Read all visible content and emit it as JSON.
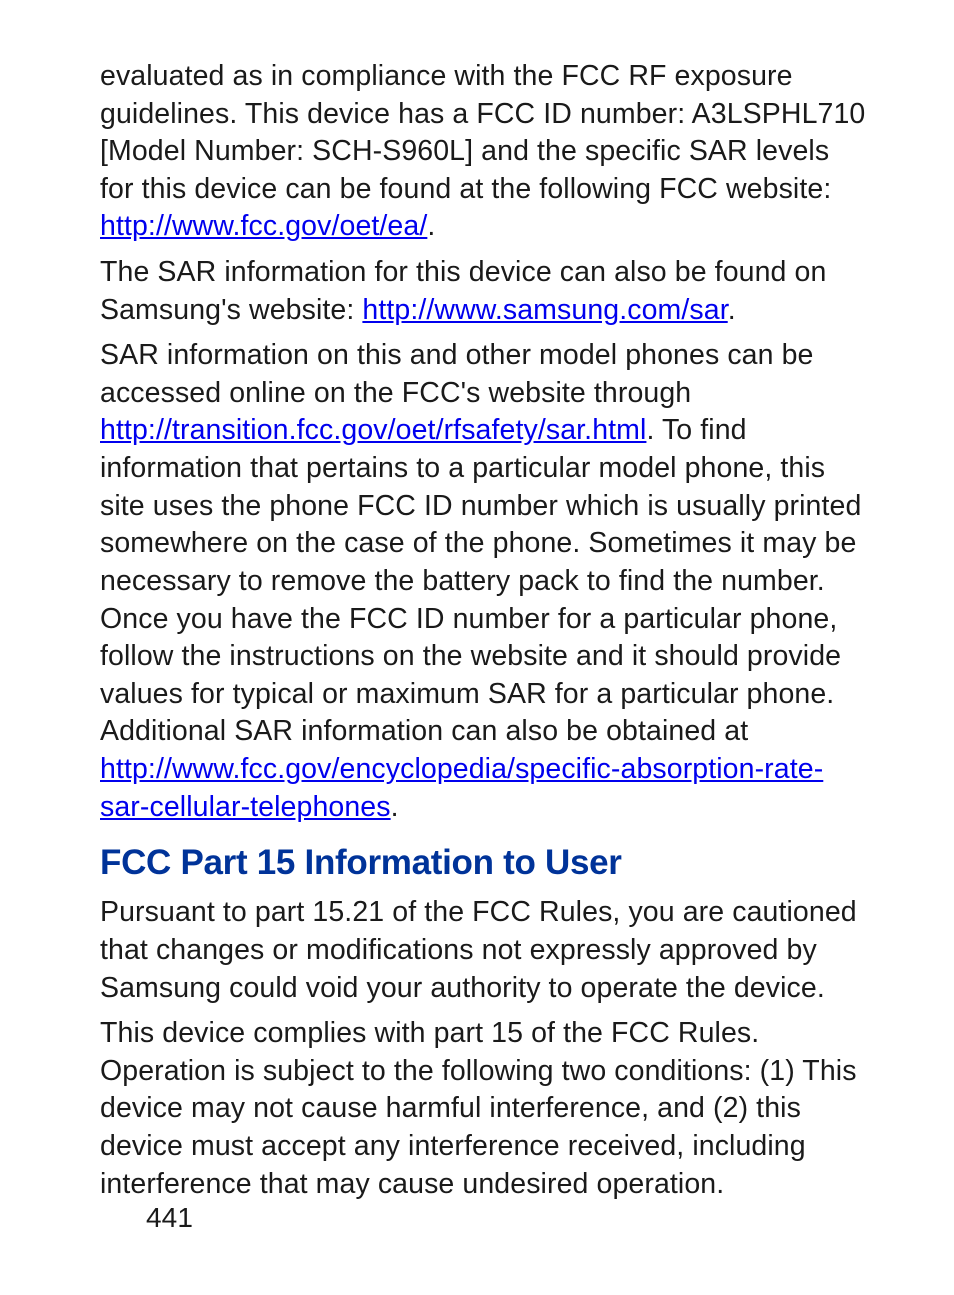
{
  "paragraphs": {
    "p1": {
      "t1": "evaluated as in compliance with the FCC RF exposure guidelines. This device has a FCC ID number: A3LSPHL710 [Model Number: SCH-S960L] and the specific SAR levels for this device can be found at the following FCC website: ",
      "link1": "http://www.fcc.gov/oet/ea/",
      "t2": "."
    },
    "p2": {
      "t1": "The SAR information for this device can also be found on Samsung's website: ",
      "link1": "http://www.samsung.com/sar",
      "t2": "."
    },
    "p3": {
      "t1": "SAR information on this and other model phones can be accessed online on the FCC's website through ",
      "link1": "http://transition.fcc.gov/oet/rfsafety/sar.html",
      "t2": ". To find information that pertains to a particular model phone, this site uses the phone FCC ID number which is usually printed somewhere on the case of the phone. Sometimes it may be necessary to remove the battery pack to find the number. Once you have the FCC ID number for a particular phone, follow the instructions on the website and it should provide values for typical or maximum SAR for a particular phone. Additional SAR information can also be obtained at ",
      "link2": "http://www.fcc.gov/encyclopedia/specific-absorption-rate-sar-cellular-telephones",
      "t3": "."
    },
    "heading1": "FCC Part 15 Information to User",
    "p4": "Pursuant to part 15.21 of the FCC Rules, you are cautioned that changes or modifications not expressly approved by Samsung could void your authority to operate the device.",
    "p5": "This device complies with part 15 of the FCC Rules. Operation is subject to the following two conditions: (1) This device may not cause harmful interference, and (2) this device must accept any interference received, including interference that may cause undesired operation."
  },
  "page_number": "441"
}
